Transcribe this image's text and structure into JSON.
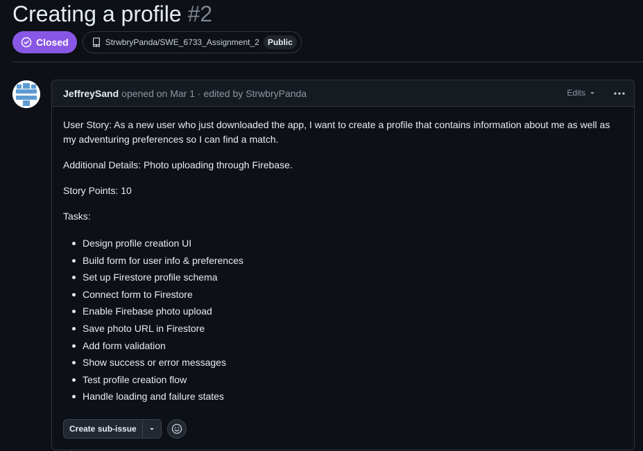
{
  "issue": {
    "title": "Creating a profile",
    "number": "#2",
    "state": "Closed",
    "repo": "StrwbryPanda/SWE_6733_Assignment_2",
    "visibility": "Public"
  },
  "comment": {
    "author": "JeffreySand",
    "meta": "opened on Mar 1 · edited by StrwbryPanda",
    "edits_label": "Edits",
    "paragraphs": [
      "User Story: As a new user who just downloaded the app, I want to create a profile that contains information about me as well as my adventuring preferences so I can find a match.",
      "Additional Details: Photo uploading through Firebase.",
      "Story Points: 10",
      "Tasks:"
    ],
    "tasks": [
      "Design profile creation UI",
      "Build form for user info & preferences",
      "Set up Firestore profile schema",
      "Connect form to Firestore",
      "Enable Firebase photo upload",
      "Save photo URL in Firestore",
      "Add form validation",
      "Show success or error messages",
      "Test profile creation flow",
      "Handle loading and failure states"
    ]
  },
  "actions": {
    "create_sub_issue": "Create sub-issue"
  },
  "colors": {
    "closed_badge": "#8957e5",
    "background": "#0d1117",
    "border": "#30363d",
    "muted_text": "#8d96a0"
  },
  "icons": [
    "closed-issue-icon",
    "repo-icon",
    "avatar-identicon",
    "triangle-down-icon",
    "kebab-horizontal-icon",
    "smiley-icon"
  ]
}
